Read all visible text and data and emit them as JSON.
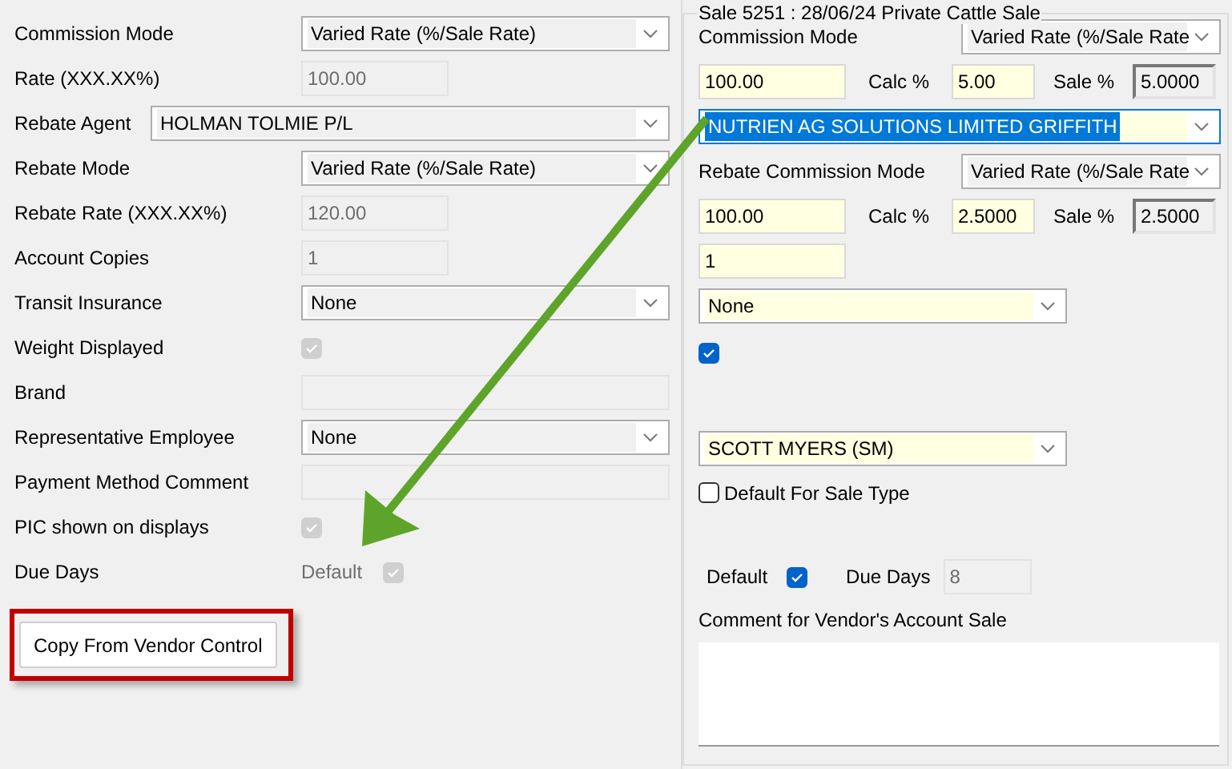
{
  "left": {
    "rows": [
      {
        "kind": "select",
        "label": "Commission Mode",
        "value": "Varied Rate (%/Sale Rate)"
      },
      {
        "kind": "input",
        "label": "Rate (XXX.XX%)",
        "value": "100.00"
      },
      {
        "kind": "wide_select",
        "label": "Rebate Agent",
        "value": "HOLMAN TOLMIE P/L"
      },
      {
        "kind": "select",
        "label": "Rebate Mode",
        "value": "Varied Rate (%/Sale Rate)"
      },
      {
        "kind": "input",
        "label": "Rebate Rate (XXX.XX%)",
        "value": "120.00"
      },
      {
        "kind": "input",
        "label": "Account Copies",
        "value": "1"
      },
      {
        "kind": "select",
        "label": "Transit Insurance",
        "value": "None"
      },
      {
        "kind": "checkbox",
        "label": "Weight Displayed",
        "checked": true
      },
      {
        "kind": "long_input",
        "label": "Brand"
      },
      {
        "kind": "select",
        "label": "Representative Employee",
        "value": "None"
      },
      {
        "kind": "long_input",
        "label": "Payment Method Comment"
      },
      {
        "kind": "checkbox",
        "label": "PIC shown on displays",
        "checked": true
      },
      {
        "kind": "due",
        "label": "Due Days",
        "value": "Default",
        "checked": true
      }
    ],
    "copy_button": "Copy From Vendor Control"
  },
  "right": {
    "title": "Sale 5251 : 28/06/24 Private Cattle Sale",
    "commission_mode": {
      "label": "Commission Mode",
      "value": "Varied Rate (%/Sale Rate"
    },
    "commission_rates": {
      "amount": "100.00",
      "calc_label": "Calc %",
      "calc": "5.00",
      "sale_label": "Sale %",
      "sale": "5.0000"
    },
    "rebate_agent": {
      "value": "NUTRIEN AG SOLUTIONS LIMITED GRIFFITH",
      "selected": true
    },
    "rebate_mode": {
      "label": "Rebate Commission Mode",
      "value": "Varied Rate (%/Sale Rate"
    },
    "rebate_rates": {
      "amount": "100.00",
      "calc_label": "Calc %",
      "calc": "2.5000",
      "sale_label": "Sale %",
      "sale": "2.5000"
    },
    "account_copies": "1",
    "transit_insurance": "None",
    "weight_displayed": {
      "checked": true
    },
    "representative": "SCOTT MYERS (SM)",
    "default_for_sale_type": {
      "label": "Default For Sale Type",
      "checked": false
    },
    "due": {
      "default_label": "Default",
      "default_checked": true,
      "due_days_label": "Due Days",
      "due_days": "8"
    },
    "comment": {
      "label": "Comment for Vendor's Account Sale"
    }
  }
}
